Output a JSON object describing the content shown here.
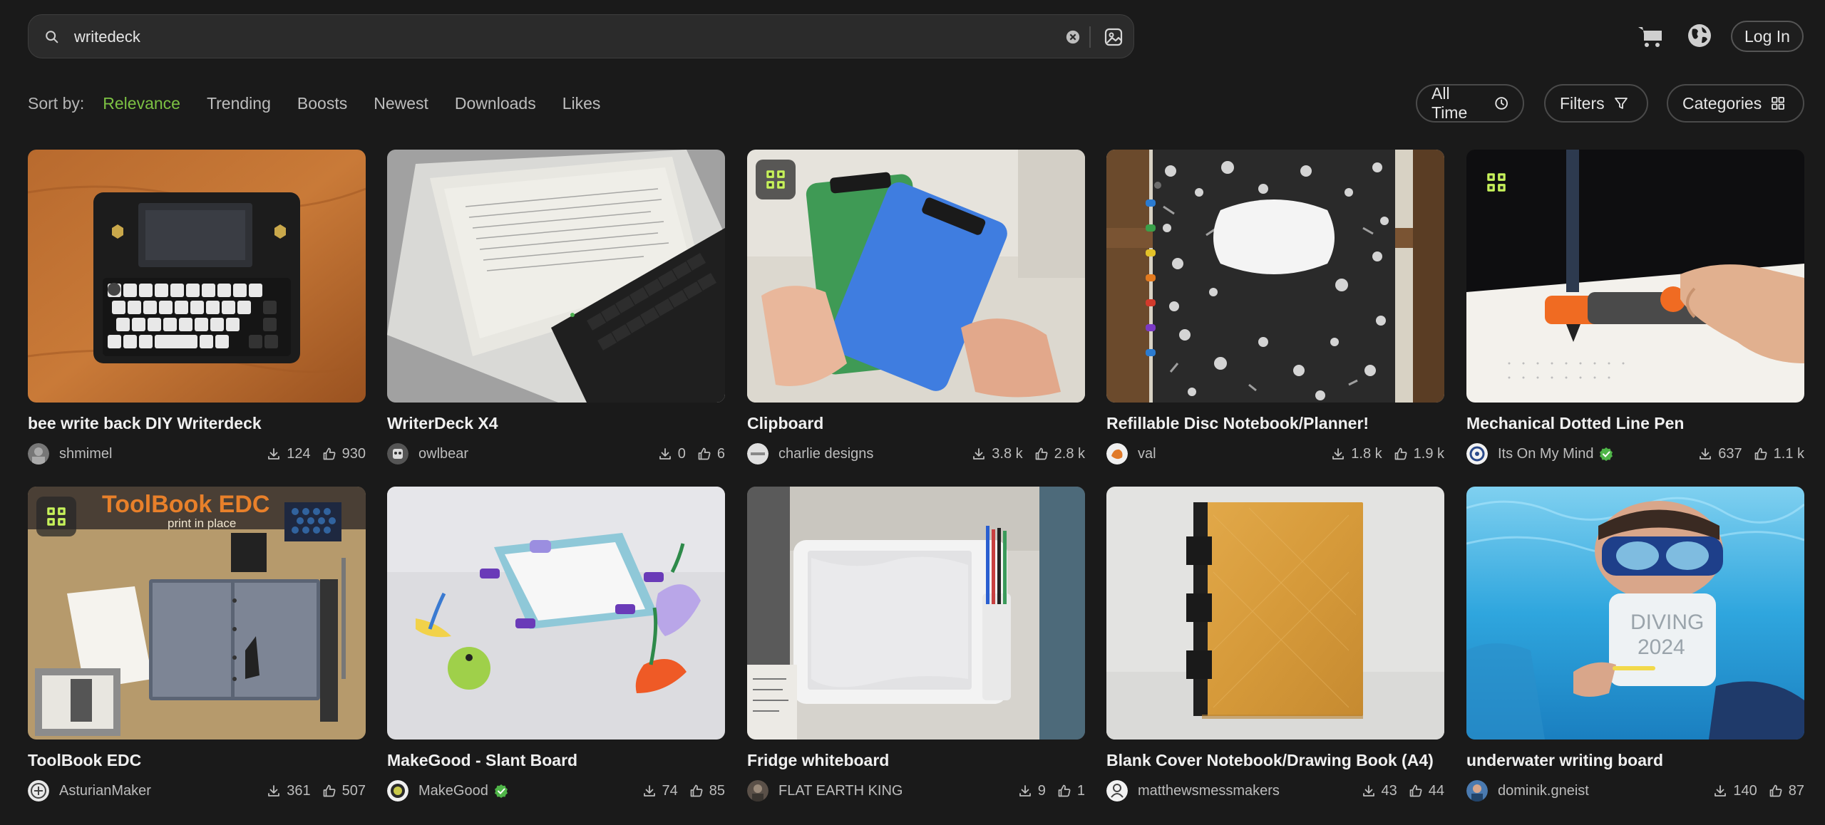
{
  "search": {
    "value": "writedeck",
    "placeholder": "Search"
  },
  "header": {
    "login_label": "Log In",
    "cart_icon": "cart-icon",
    "globe_icon": "globe-icon"
  },
  "sort": {
    "label": "Sort by:",
    "options": [
      "Relevance",
      "Trending",
      "Boosts",
      "Newest",
      "Downloads",
      "Likes"
    ],
    "active": "Relevance"
  },
  "filters": {
    "time_label": "All Time",
    "filters_label": "Filters",
    "categories_label": "Categories"
  },
  "colors": {
    "background": "#1a1a1a",
    "accent": "#7cc143",
    "badge_green": "#c6f15a"
  },
  "cards": [
    {
      "title": "bee write back DIY Writerdeck",
      "author": "shmimel",
      "downloads": "124",
      "likes": "930",
      "verified": false
    },
    {
      "title": "WriterDeck X4",
      "author": "owlbear",
      "downloads": "0",
      "likes": "6",
      "verified": false
    },
    {
      "title": "Clipboard",
      "author": "charlie designs",
      "downloads": "3.8 k",
      "likes": "2.8 k",
      "verified": false
    },
    {
      "title": "Refillable Disc Notebook/Planner!",
      "author": "val",
      "downloads": "1.8 k",
      "likes": "1.9 k",
      "verified": false
    },
    {
      "title": "Mechanical Dotted Line Pen",
      "author": "Its On My Mind",
      "downloads": "637",
      "likes": "1.1 k",
      "verified": true
    },
    {
      "title": "ToolBook EDC",
      "author": "AsturianMaker",
      "downloads": "361",
      "likes": "507",
      "verified": false
    },
    {
      "title": "MakeGood - Slant Board",
      "author": "MakeGood",
      "downloads": "74",
      "likes": "85",
      "verified": true
    },
    {
      "title": "Fridge whiteboard",
      "author": "FLAT EARTH KING",
      "downloads": "9",
      "likes": "1",
      "verified": false
    },
    {
      "title": "Blank Cover Notebook/Drawing Book (A4)",
      "author": "matthewsmessmakers",
      "downloads": "43",
      "likes": "44",
      "verified": false
    },
    {
      "title": "underwater writing board",
      "author": "dominik.gneist",
      "downloads": "140",
      "likes": "87",
      "verified": false
    }
  ],
  "image_text": {
    "toolbook_title": "ToolBook EDC",
    "toolbook_sub": "print in place",
    "diving_line1": "DIVING",
    "diving_line2": "2024"
  }
}
